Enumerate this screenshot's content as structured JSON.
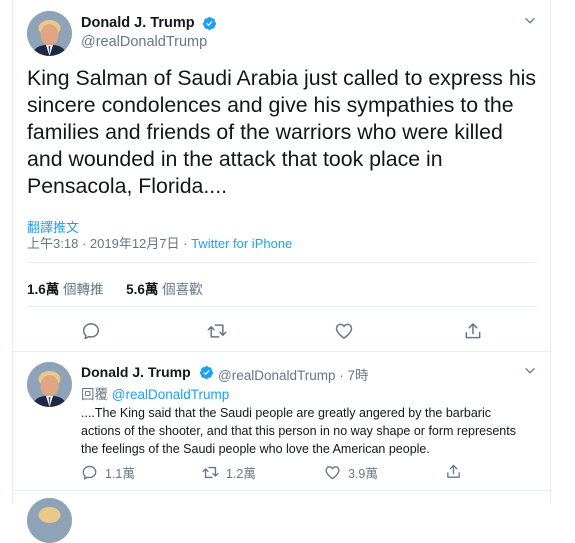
{
  "tweet": {
    "display_name": "Donald J. Trump",
    "handle": "@realDonaldTrump",
    "text": "King Salman of Saudi Arabia just called to express his sincere condolences and give his sympathies to the families and friends of the warriors who were killed and wounded in the attack that took place in Pensacola, Florida....",
    "translate_label": "翻譯推文",
    "time": "上午3:18",
    "date": "2019年12月7日",
    "meta_sep": "·",
    "source": "Twitter for iPhone",
    "retweets_count": "1.6萬",
    "retweets_label": "個轉推",
    "likes_count": "5.6萬",
    "likes_label": "個喜歡"
  },
  "reply": {
    "display_name": "Donald J. Trump",
    "handle": "@realDonaldTrump",
    "sep": "·",
    "time_ago": "7時",
    "reply_prefix": "回覆",
    "reply_to": "@realDonaldTrump",
    "text": "....The King said that the Saudi people are greatly angered by the barbaric actions of the shooter, and that this person in no way shape or form represents the feelings of the Saudi people who love the American people.",
    "reply_count": "1.1萬",
    "retweet_count": "1.2萬",
    "like_count": "3.9萬"
  },
  "colors": {
    "accent": "#1da1f2",
    "muted": "#657786",
    "text": "#14171a",
    "border": "#e6ecf0"
  },
  "icons": [
    "verified-badge-icon",
    "chevron-down-icon",
    "reply-icon",
    "retweet-icon",
    "like-icon",
    "share-icon"
  ]
}
